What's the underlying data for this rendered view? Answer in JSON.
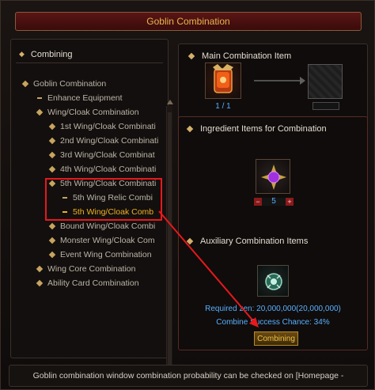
{
  "window": {
    "title": "Goblin Combination"
  },
  "left_panel": {
    "header": "Combining",
    "tree": [
      {
        "label": "Goblin Combination",
        "type": "diamond"
      },
      {
        "label": "Enhance Equipment",
        "type": "dash"
      },
      {
        "label": "Wing/Cloak Combination",
        "type": "diamond"
      },
      {
        "label": "1st Wing/Cloak Combinati",
        "type": "diamond"
      },
      {
        "label": "2nd Wing/Cloak Combinati",
        "type": "diamond"
      },
      {
        "label": "3rd Wing/Cloak Combinat",
        "type": "diamond"
      },
      {
        "label": "4th Wing/Cloak Combinati",
        "type": "diamond"
      },
      {
        "label": "5th Wing/Cloak Combinati",
        "type": "diamond"
      },
      {
        "label": "5th Wing Relic Combi",
        "type": "dash"
      },
      {
        "label": "5th Wing/Cloak Comb",
        "type": "dash-selected"
      },
      {
        "label": "Bound Wing/Cloak Combi",
        "type": "diamond"
      },
      {
        "label": "Monster Wing/Cloak Com",
        "type": "diamond"
      },
      {
        "label": "Event Wing Combination",
        "type": "diamond"
      },
      {
        "label": "Wing Core Combination",
        "type": "diamond"
      },
      {
        "label": "Ability Card Combination",
        "type": "diamond"
      }
    ]
  },
  "main_item": {
    "label": "Main Combination Item",
    "count": "1 / 1",
    "icon": "wing-relic-icon"
  },
  "ingredients": {
    "label": "Ingredient Items for Combination",
    "quantity": "5",
    "minus": "−",
    "plus": "+",
    "icon": "purple-gem-icon"
  },
  "auxiliary": {
    "label": "Auxiliary Combination Items",
    "icon": "green-talisman-icon"
  },
  "info": {
    "required_zen": "Required zen: 20,000,000(20,000,000)",
    "success_chance": "Combine Success Chance: 34%"
  },
  "combine_button": "Combining",
  "footer": "Goblin combination window combination probability can be checked on [Homepage -"
}
